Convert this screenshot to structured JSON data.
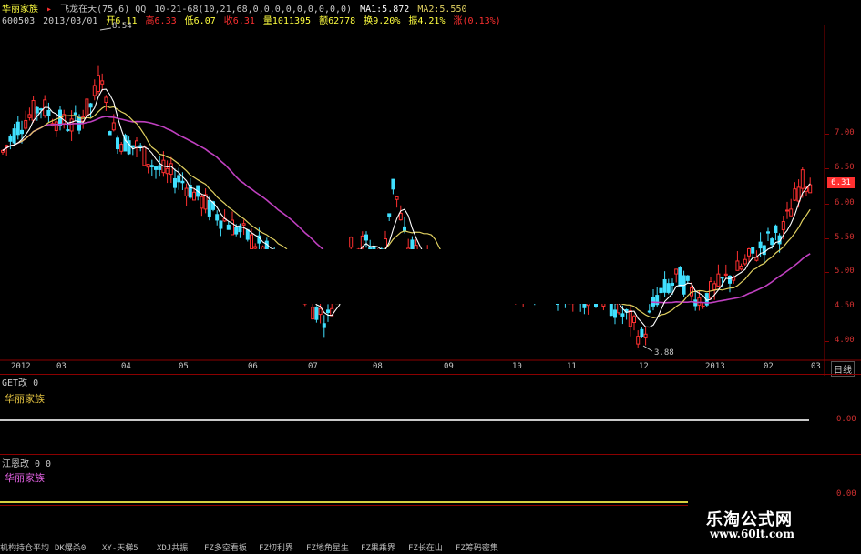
{
  "header": {
    "stock_name": "华丽家族",
    "formula": "飞龙在天(75,6) QQ",
    "params": "10-21-68(10,21,68,0,0,0,0,0,0,0,0,0)",
    "ma1": "MA1:5.872",
    "ma2": "MA2:5.550",
    "code": "600503",
    "date": "2013/03/01",
    "open": "开6.11",
    "high": "高6.33",
    "low": "低6.07",
    "close": "收6.31",
    "volume": "量1011395",
    "amount": "额62778",
    "turnover": "换9.20%",
    "amplitude": "振4.21%",
    "change": "涨(0.13%)"
  },
  "main_chart": {
    "high_marker": "8.54",
    "low_marker": "3.88",
    "current_price": "6.31",
    "y_ticks": [
      "7.00",
      "6.50",
      "6.00",
      "5.50",
      "5.00",
      "4.50",
      "4.00"
    ],
    "x_ticks": [
      "2012",
      "03",
      "04",
      "05",
      "06",
      "07",
      "08",
      "09",
      "10",
      "11",
      "12",
      "2013",
      "02",
      "03"
    ],
    "period_button": "日线"
  },
  "panel2": {
    "title": "GET改 0",
    "label": "华丽家族",
    "y_tick": "0.00"
  },
  "panel3": {
    "title": "江恩改 0 0",
    "label": "华丽家族",
    "y_tick": "0.00"
  },
  "watermark": {
    "line1": "乐淘公式网",
    "line2": "www.60lt.com"
  },
  "tabs": [
    "机构持仓平均",
    "DK爆杀0",
    "XY-天梯5",
    "XDJ共振",
    "FZ多空看板",
    "FZ切利界",
    "FZ地角星生",
    "FZ果乘界",
    "FZ长在山",
    "FZ筹码密集"
  ],
  "colors": {
    "up": "#ff3030",
    "down": "#40e0ff",
    "ma_short": "#ffffff",
    "ma_mid": "#e0d060",
    "ma_long": "#c040c0",
    "grid_red": "#8b0000"
  }
}
